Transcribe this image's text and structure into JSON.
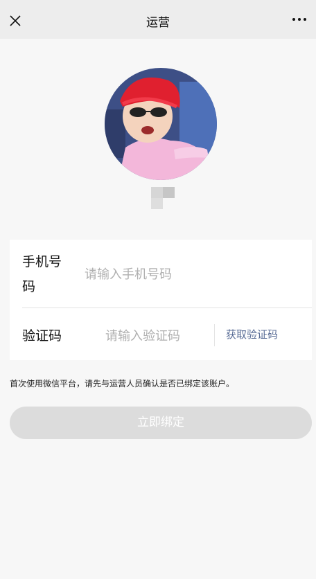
{
  "header": {
    "title": "运营",
    "close_icon": "close-icon",
    "more_icon": "more-icon"
  },
  "profile": {
    "avatar": "user-avatar",
    "name_masked": "pixelated-name"
  },
  "form": {
    "phone_label": "手机号码",
    "phone_placeholder": "请输入手机号码",
    "phone_value": "",
    "code_label": "验证码",
    "code_placeholder": "请输入验证码",
    "code_value": "",
    "get_code_label": "获取验证码"
  },
  "notice": "首次使用微信平台，请先与运营人员确认是否已绑定该账户。",
  "bind_button": {
    "label": "立即绑定",
    "disabled": true
  },
  "colors": {
    "topbar": "#ededed",
    "background": "#f7f7f7",
    "link": "#576b95",
    "disabled_button": "#dcdcdc"
  }
}
